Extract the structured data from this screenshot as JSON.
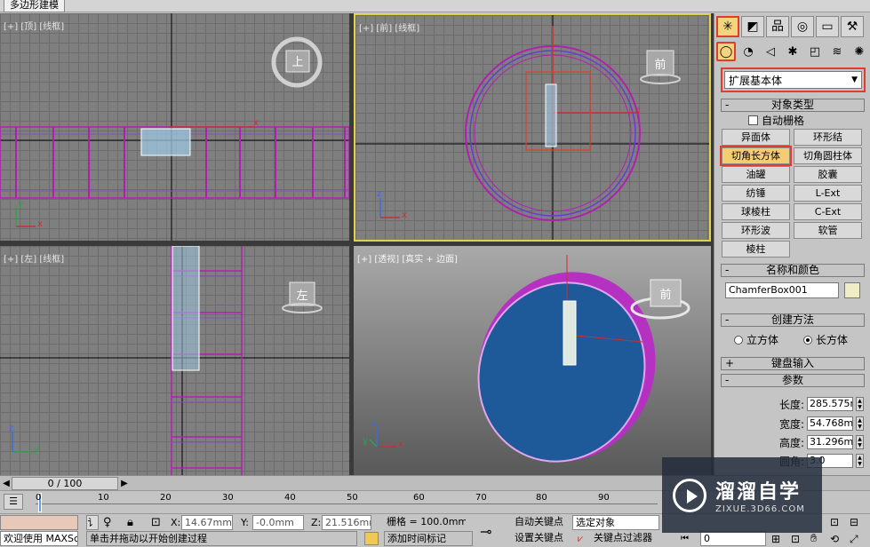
{
  "ribbon": {
    "tab_label": "多边形建模"
  },
  "viewports": {
    "top": {
      "label": "[+] [顶] [线框]",
      "viewcube": "上"
    },
    "front": {
      "label": "[+] [前] [线框]",
      "viewcube": "前"
    },
    "left": {
      "label": "[+] [左] [线框]",
      "viewcube": "左"
    },
    "persp": {
      "label": "[+] [透视] [真实 + 边面]",
      "viewcube": "前"
    },
    "axis_x": "x",
    "axis_y": "y",
    "axis_z": "z"
  },
  "command_panel": {
    "tab_icons": [
      "create-icon",
      "modify-icon",
      "hierarchy-icon",
      "motion-icon",
      "display-icon",
      "utilities-icon"
    ],
    "tab_glyphs": [
      "✳",
      "◩",
      "品",
      "◎",
      "▭",
      "⚒"
    ],
    "sub_glyphs": [
      "◯",
      "◔",
      "◁",
      "✱",
      "◰",
      "≋",
      "✺"
    ],
    "category": "扩展基本体",
    "object_type_title": "对象类型",
    "auto_grid_label": "自动栅格",
    "object_buttons": [
      "异面体",
      "环形结",
      "切角长方体",
      "切角圆柱体",
      "油罐",
      "胶囊",
      "纺锤",
      "L-Ext",
      "球棱柱",
      "C-Ext",
      "环形波",
      "软管",
      "棱柱"
    ],
    "active_object": "切角长方体",
    "name_color_title": "名称和颜色",
    "object_name": "ChamferBox001",
    "creation_method_title": "创建方法",
    "method_cube": "立方体",
    "method_box": "长方体",
    "keyboard_entry_title": "键盘输入",
    "params_title": "参数",
    "length_label": "长度:",
    "length_value": "285.575m",
    "width_label": "宽度:",
    "width_value": "54.768mm",
    "height_label": "高度:",
    "height_value": "31.296mm",
    "fillet_label": "圆角:",
    "fillet_value": "3.0"
  },
  "timeline": {
    "frame": "0 / 100",
    "ticks": [
      "0",
      "10",
      "20",
      "30",
      "40",
      "50",
      "60",
      "70",
      "80",
      "90"
    ]
  },
  "status": {
    "script_text": "欢迎使用 MAXSc",
    "prompt_text": "单击并拖动以开始创建过程",
    "x_label": "X:",
    "x_value": "14.67mm",
    "y_label": "Y:",
    "y_value": "-0.0mm",
    "z_label": "Z:",
    "z_value": "21.516mm",
    "grid_text": "栅格 = 100.0mm",
    "add_time_tag": "添加时间标记",
    "auto_key": "自动关键点",
    "set_key": "设置关键点",
    "selected_object": "选定对象",
    "key_filters": "关键点过滤器",
    "frame_field": "0"
  },
  "watermark": {
    "title": "溜溜自学",
    "url": "ZIXUE.3D66.COM"
  },
  "colors": {
    "selection_red": "#e23c2c",
    "active_yellow": "#e4d14a",
    "wire_magenta": "#b020b0",
    "persp_blue": "#1e5a9a"
  }
}
